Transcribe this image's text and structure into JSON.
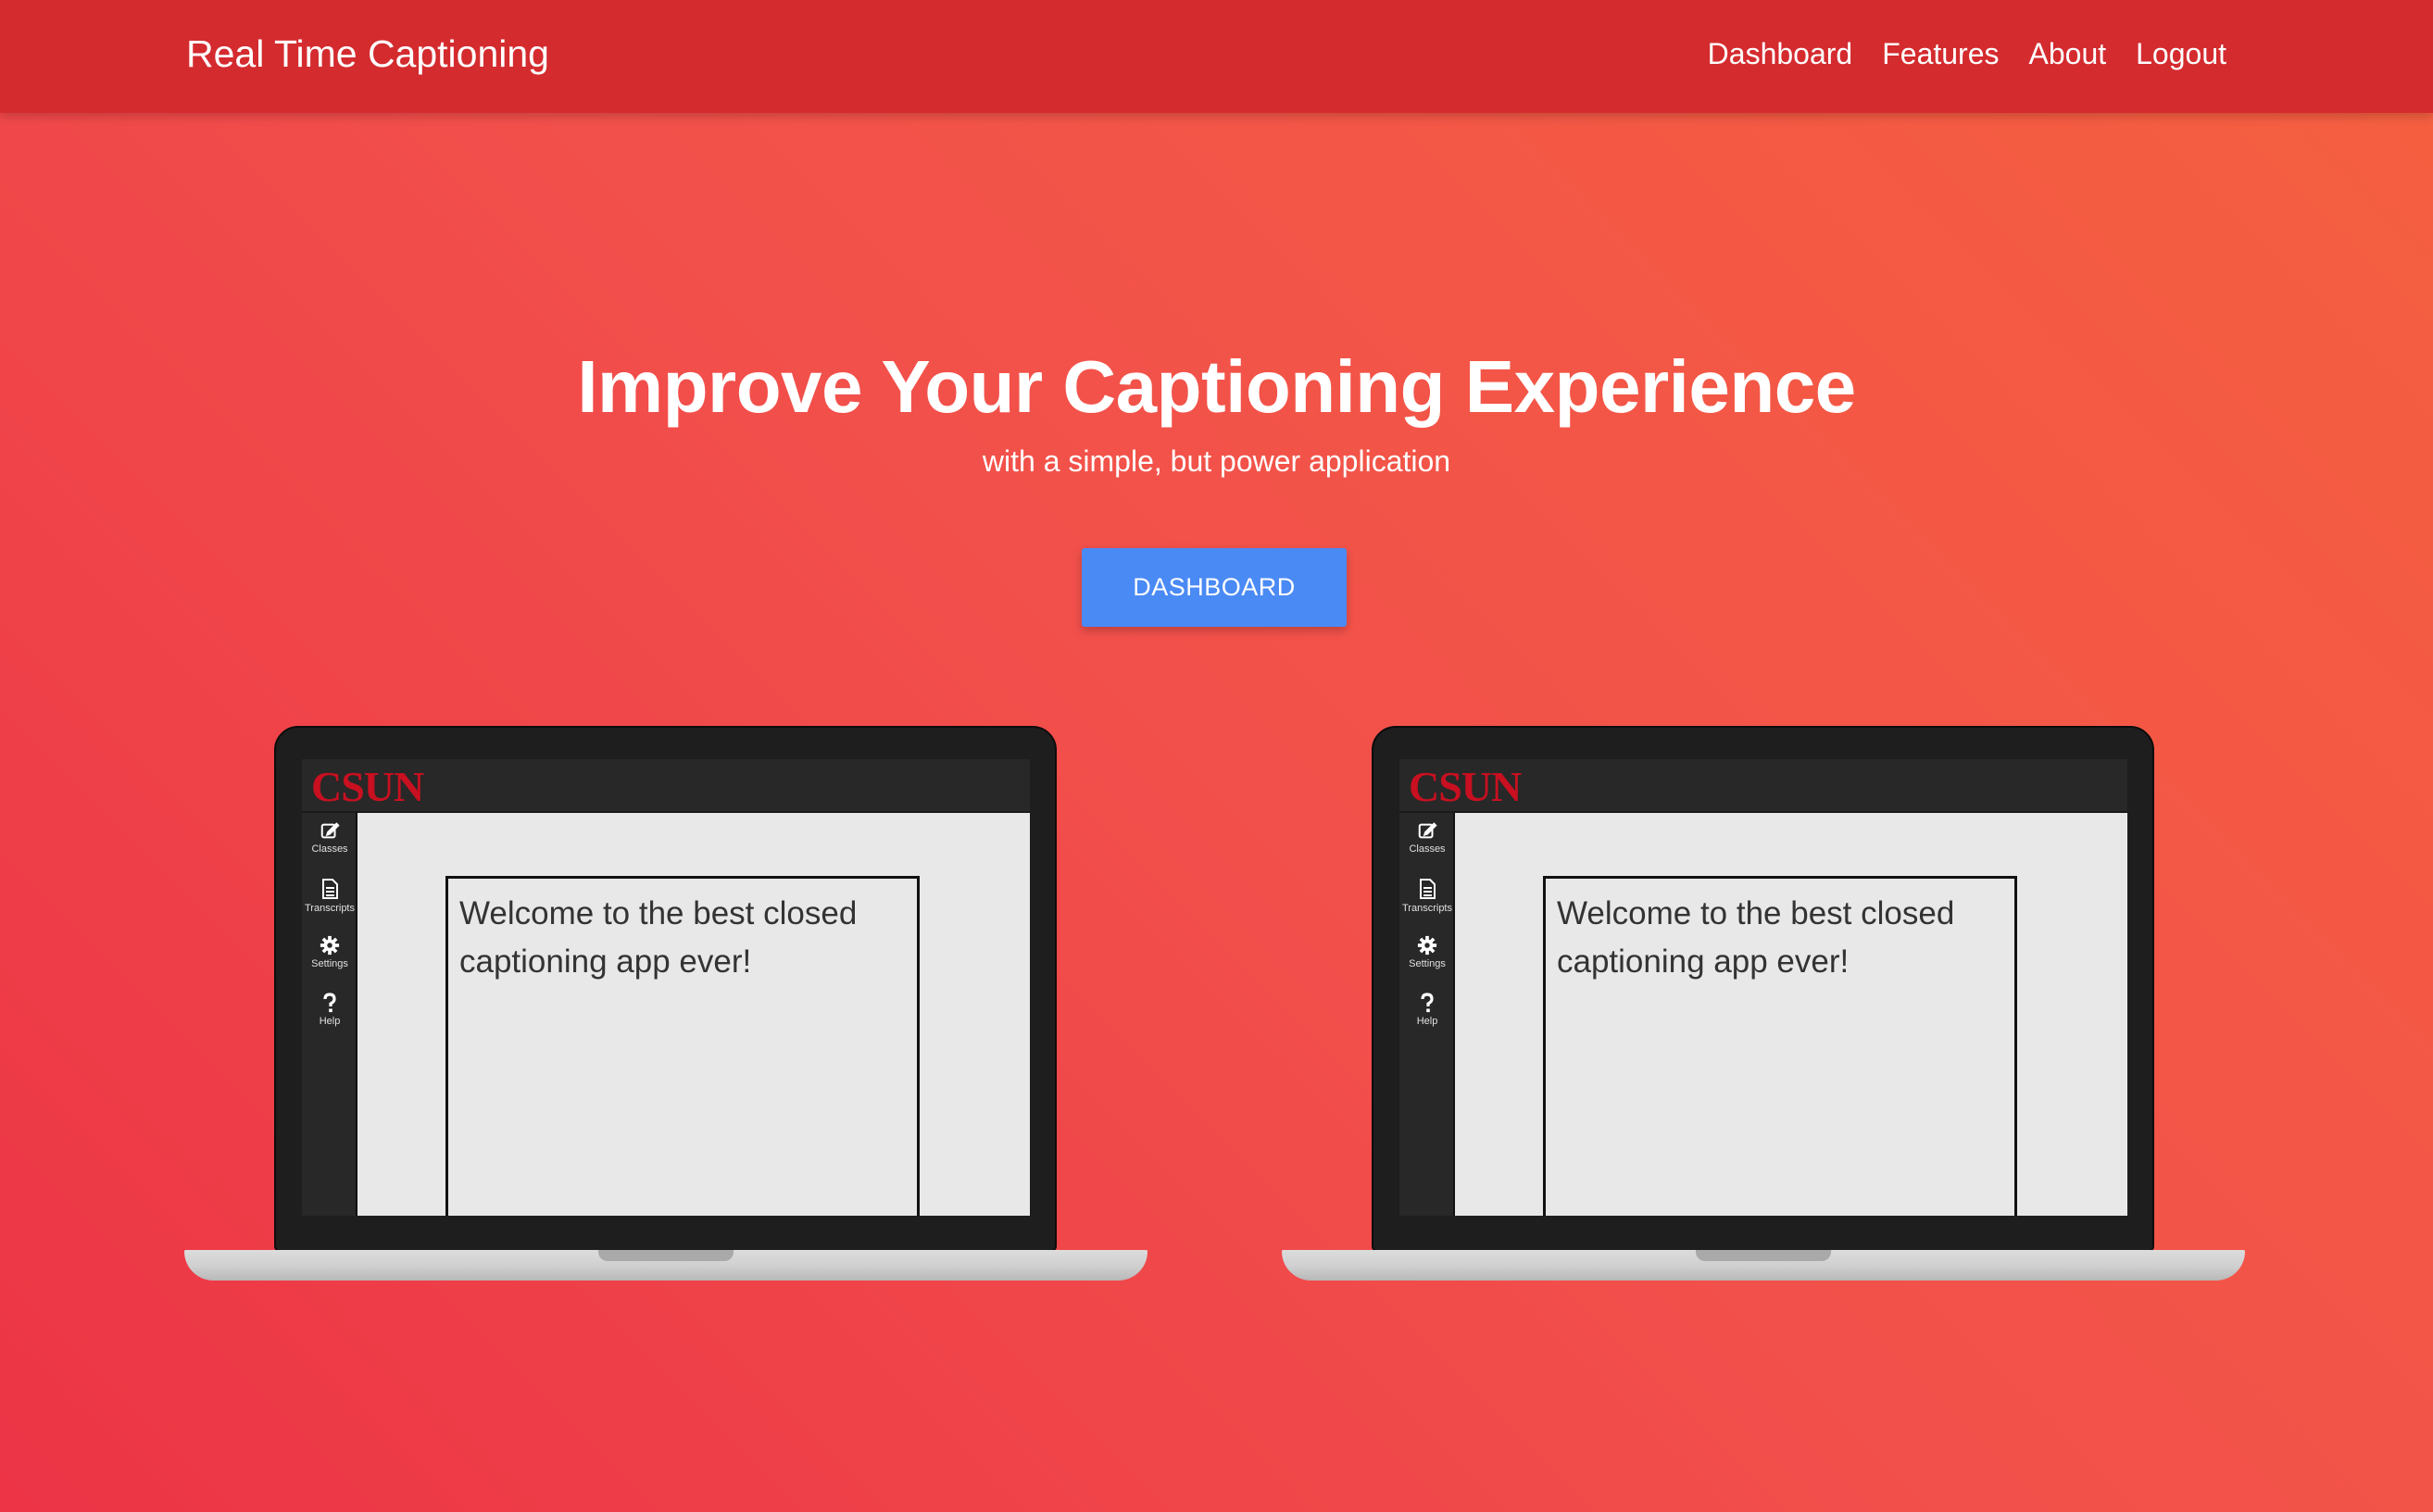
{
  "navbar": {
    "brand": "Real Time Captioning",
    "links": [
      {
        "label": "Dashboard"
      },
      {
        "label": "Features"
      },
      {
        "label": "About"
      },
      {
        "label": "Logout"
      }
    ]
  },
  "hero": {
    "title": "Improve Your Captioning Experience",
    "subtitle": "with a simple, but power application",
    "cta_label": "DASHBOARD"
  },
  "laptops": [
    {
      "logo": "CSUN",
      "sidebar": [
        {
          "label": "Classes",
          "icon": "edit-icon"
        },
        {
          "label": "Transcripts",
          "icon": "document-icon"
        },
        {
          "label": "Settings",
          "icon": "gear-icon"
        },
        {
          "label": "Help",
          "icon": "question-icon"
        }
      ],
      "caption": "Welcome to the best closed captioning app ever!"
    },
    {
      "logo": "CSUN",
      "sidebar": [
        {
          "label": "Classes",
          "icon": "edit-icon"
        },
        {
          "label": "Transcripts",
          "icon": "document-icon"
        },
        {
          "label": "Settings",
          "icon": "gear-icon"
        },
        {
          "label": "Help",
          "icon": "question-icon"
        }
      ],
      "caption": "Welcome to the best closed captioning app ever!"
    }
  ],
  "colors": {
    "navbar": "#d42b2f",
    "background_start": "#ec3446",
    "background_end": "#f5603f",
    "cta": "#4a8af4",
    "logo": "#c81020"
  }
}
